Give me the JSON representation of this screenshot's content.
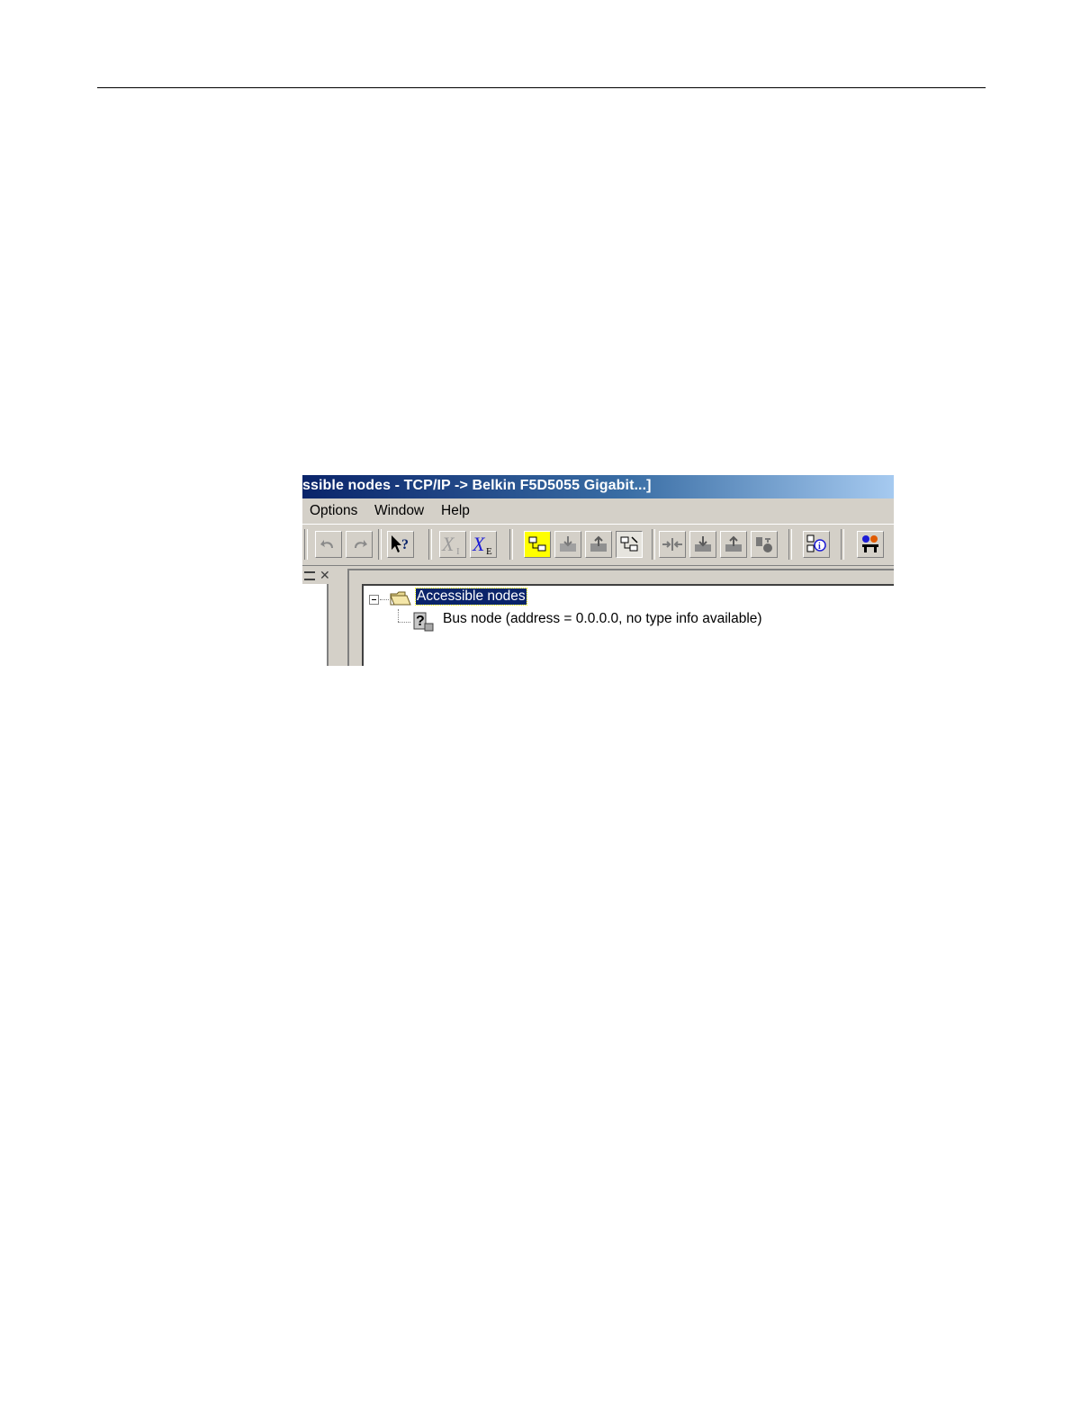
{
  "window": {
    "title": "ssible nodes - TCP/IP -> Belkin F5D5055 Gigabit...]"
  },
  "menu": {
    "items": [
      "Options",
      "Window",
      "Help"
    ]
  },
  "toolbar": {
    "buttons": [
      "undo-icon",
      "redo-icon",
      "context-help-icon",
      "import-icon",
      "export-icon",
      "network-view-icon",
      "download-icon",
      "upload-icon",
      "scan-network-icon",
      "connect-icon",
      "download-all-icon",
      "upload-all-icon",
      "device-info-icon",
      "node-info-icon",
      "settings-icon"
    ]
  },
  "tree": {
    "root_label": "Accessible nodes",
    "child_label": "Bus node (address = 0.0.0.0, no type info available)"
  },
  "colors": {
    "title_start": "#0a246a",
    "title_end": "#a6caf0",
    "face": "#d4d0c8",
    "selection": "#0a246a",
    "highlight_button": "#ffff00"
  }
}
